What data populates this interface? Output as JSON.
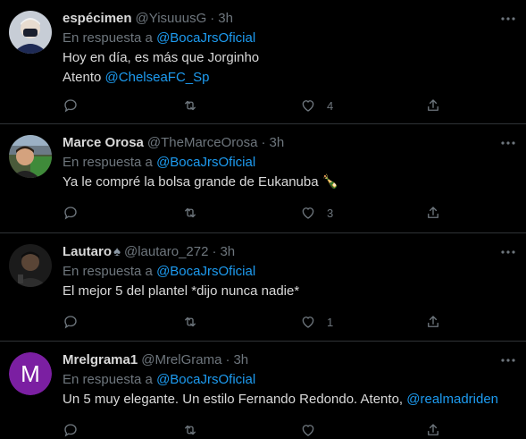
{
  "colors": {
    "background": "#000000",
    "text": "#d9d9d9",
    "muted": "#6e767d",
    "link": "#1d9bf0",
    "divider": "#2f3336"
  },
  "reply_prefix": "En respuesta a",
  "separator": "·",
  "tweets": [
    {
      "display_name": "espécimen",
      "handle": "@YisuuusG",
      "time": "3h",
      "reply_to": "@BocaJrsOficial",
      "line1": "Hoy en día, es más que Jorginho",
      "line2_prefix": "Atento ",
      "line2_mention": "@ChelseaFC_Sp",
      "likes": "4",
      "avatar_icon": "masked-person-avatar"
    },
    {
      "display_name": "Marce Orosa",
      "handle": "@TheMarceOrosa",
      "time": "3h",
      "reply_to": "@BocaJrsOficial",
      "line1": "Ya le compré la bolsa grande de Eukanuba 🍾",
      "likes": "3",
      "avatar_icon": "stadium-selfie-avatar"
    },
    {
      "display_name": "Lautaro",
      "name_suffix": "♠",
      "handle": "@lautaro_272",
      "time": "3h",
      "reply_to": "@BocaJrsOficial",
      "line1": "El mejor 5 del plantel *dijo nunca nadie*",
      "likes": "1",
      "avatar_icon": "dark-photo-avatar"
    },
    {
      "display_name": "Mrelgrama1",
      "handle": "@MrelGrama",
      "time": "3h",
      "reply_to": "@BocaJrsOficial",
      "line1_prefix": "Un 5 muy elegante. Un estilo Fernando Redondo. Atento, ",
      "line1_mention": "@realmadriden",
      "avatar_letter": "M",
      "avatar_color": "#7b1fa2"
    }
  ]
}
